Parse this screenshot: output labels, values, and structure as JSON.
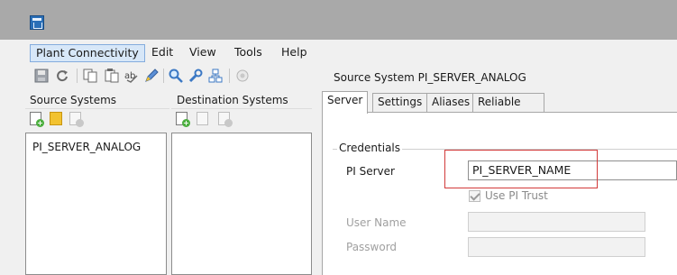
{
  "menu": {
    "items": [
      "Plant Connectivity",
      "Edit",
      "View",
      "Tools",
      "Help"
    ]
  },
  "toolbar": {
    "icons": [
      "save-icon",
      "refresh-icon",
      "copy-icon",
      "paste-icon",
      "spell-check-icon",
      "edit-icon",
      "search-icon",
      "tools-icon",
      "network-icon",
      "settings-icon"
    ]
  },
  "source_systems": {
    "label": "Source Systems",
    "items": [
      "PI_SERVER_ANALOG"
    ]
  },
  "destination_systems": {
    "label": "Destination Systems",
    "items": []
  },
  "detail": {
    "title": "Source System PI_SERVER_ANALOG",
    "tabs": [
      "Server",
      "Settings",
      "Aliases",
      "Reliable Connection"
    ],
    "active_tab": "Server",
    "credentials": {
      "group_label": "Credentials",
      "pi_server_label": "PI Server",
      "pi_server_value": "PI_SERVER_NAME",
      "use_pi_trust_label": "Use PI Trust",
      "use_pi_trust_checked": true,
      "user_name_label": "User Name",
      "user_name_value": "",
      "password_label": "Password",
      "password_value": ""
    }
  },
  "colors": {
    "highlight": "#d23a3a",
    "menu_active": "#d7e7f8"
  }
}
